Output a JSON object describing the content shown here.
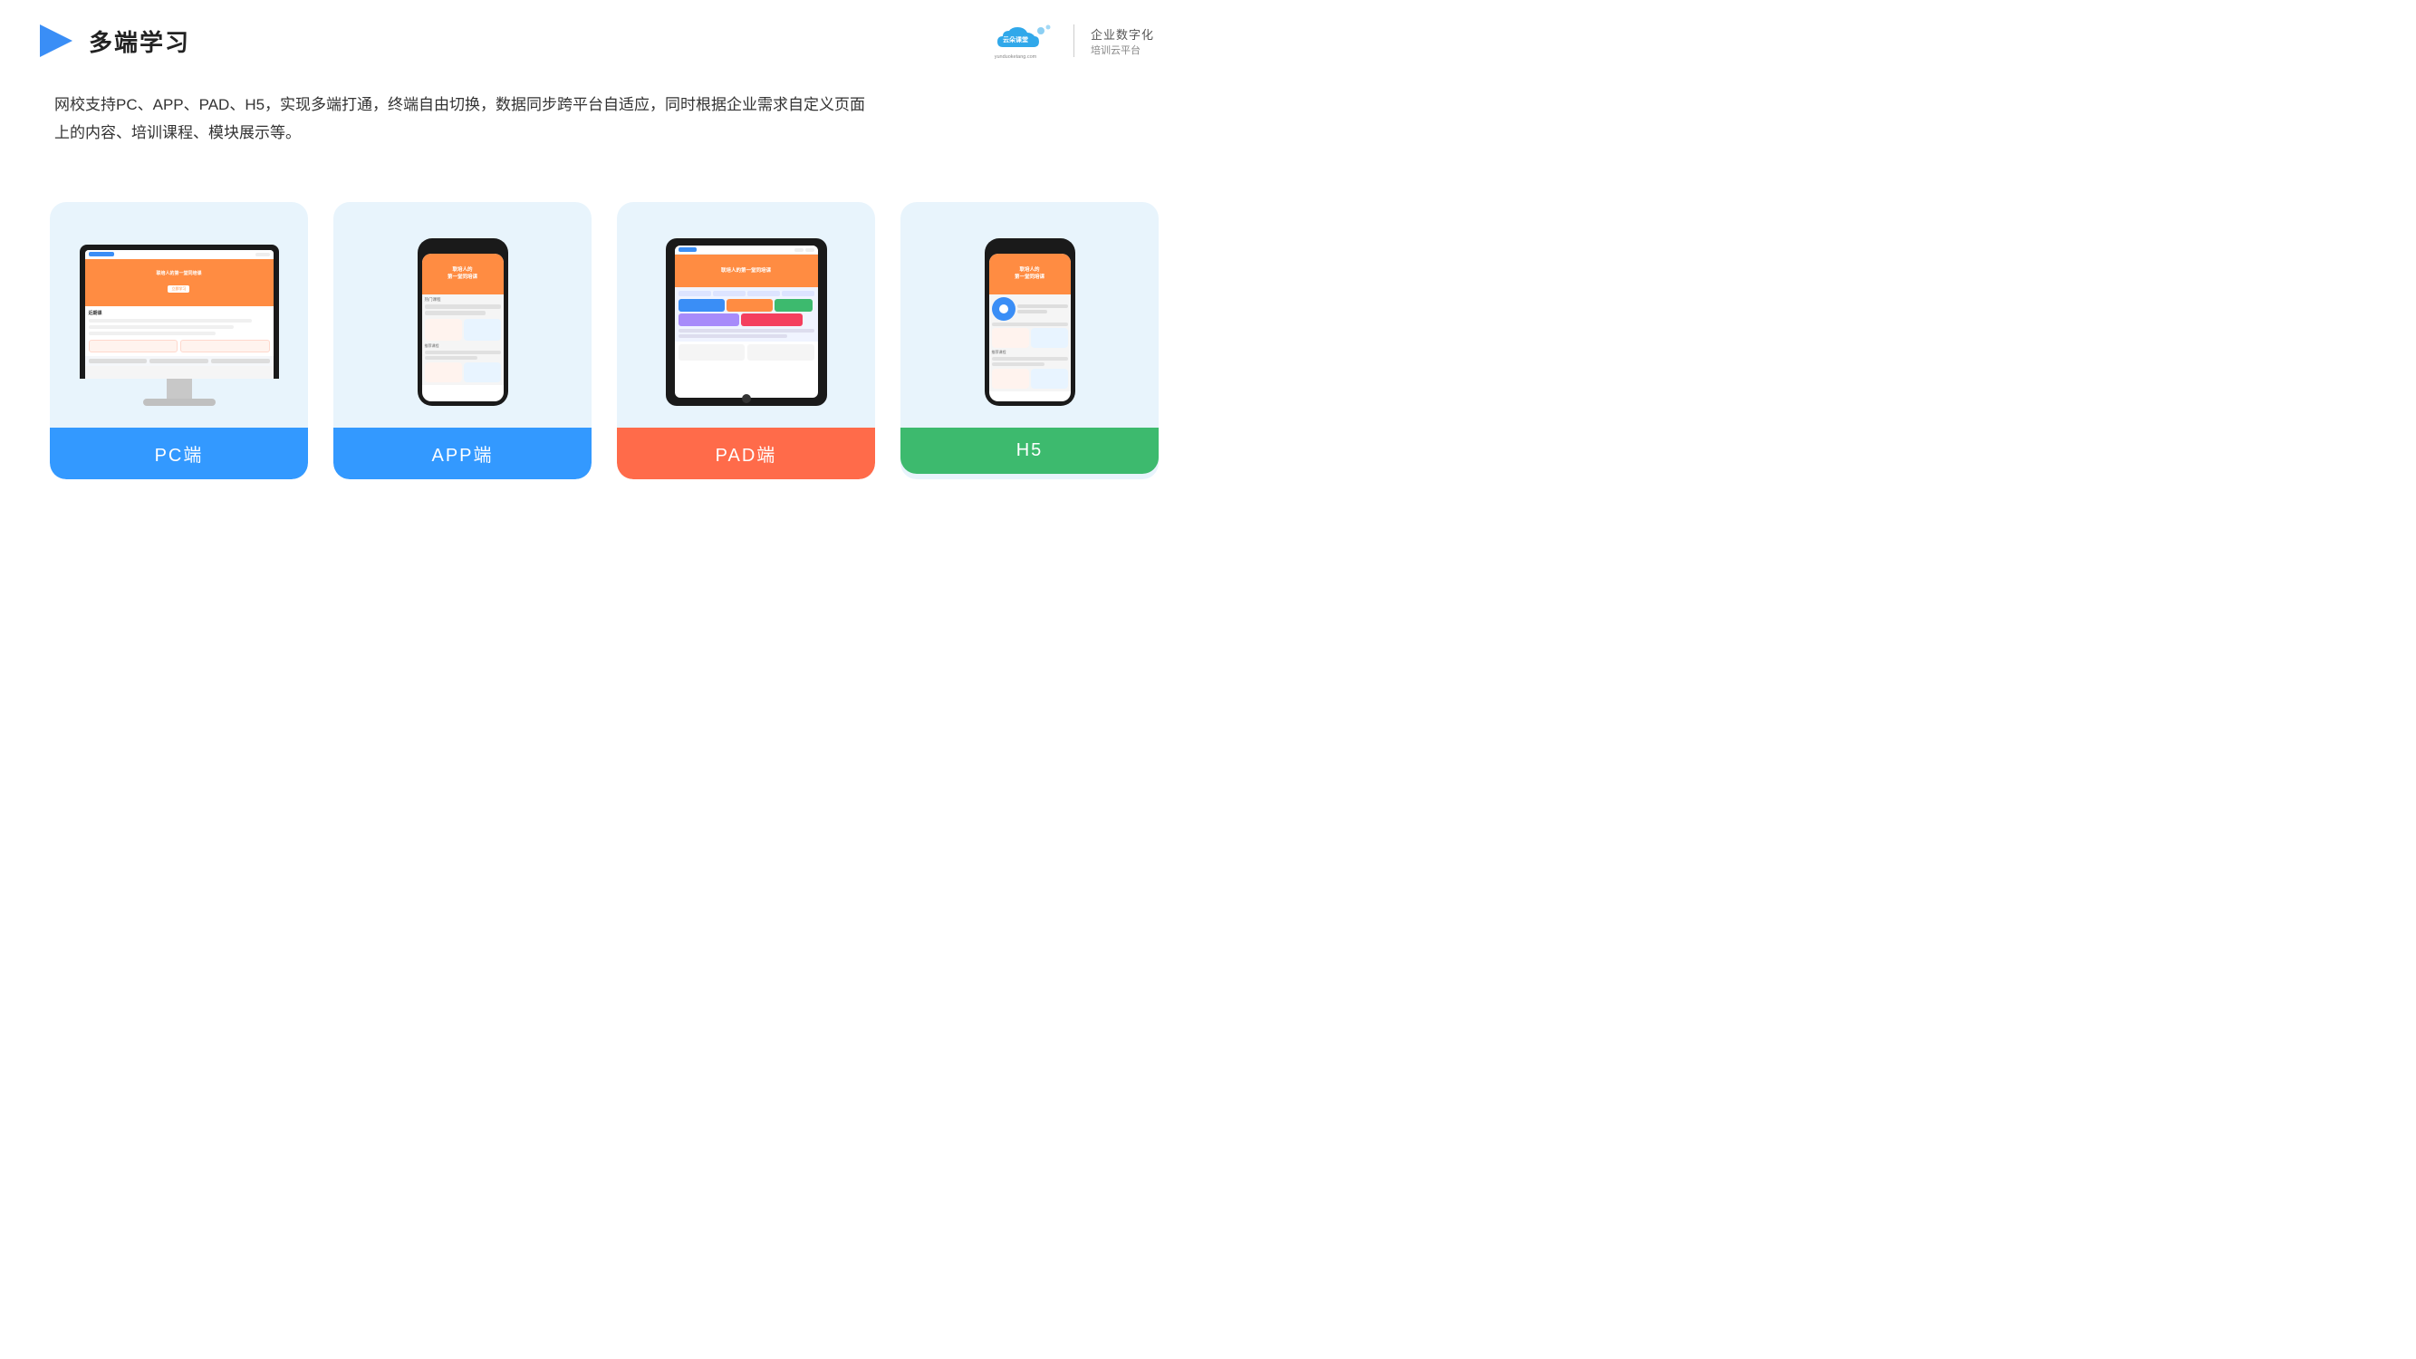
{
  "header": {
    "title": "多端学习",
    "logo_domain": "yunduoketang.com",
    "logo_line1": "企业数字化",
    "logo_line2": "培训云平台"
  },
  "description": {
    "text": "网校支持PC、APP、PAD、H5，实现多端打通，终端自由切换，数据同步跨平台自适应，同时根据企业需求自定义页面上的内容、培训课程、模块展示等。"
  },
  "cards": [
    {
      "id": "pc",
      "label": "PC端",
      "color": "#3399ff"
    },
    {
      "id": "app",
      "label": "APP端",
      "color": "#3399ff"
    },
    {
      "id": "pad",
      "label": "PAD端",
      "color": "#ff6b4a"
    },
    {
      "id": "h5",
      "label": "H5",
      "color": "#3dba6e"
    }
  ]
}
